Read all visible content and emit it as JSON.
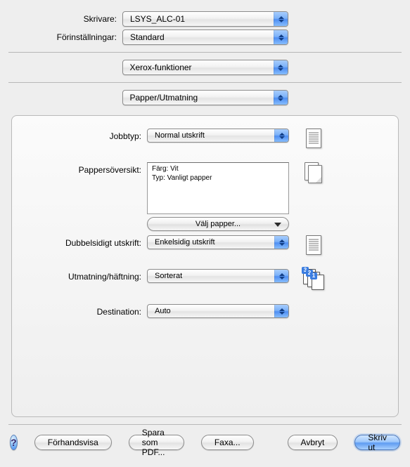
{
  "top": {
    "printer_label": "Skrivare:",
    "printer_value": "LSYS_ALC-01",
    "preset_label": "Förinställningar:",
    "preset_value": "Standard",
    "feature_group": "Xerox-funktioner",
    "feature_sub": "Papper/Utmatning"
  },
  "panel": {
    "jobtype_label": "Jobbtyp:",
    "jobtype_value": "Normal utskrift",
    "paper_label": "Pappersöversikt:",
    "paper_line1": "Färg: Vit",
    "paper_line2": "Typ: Vanligt papper",
    "paper_picker": "Välj papper...",
    "duplex_label": "Dubbelsidigt utskrift:",
    "duplex_value": "Enkelsidig utskrift",
    "output_label": "Utmatning/häftning:",
    "output_value": "Sorterat",
    "dest_label": "Destination:",
    "dest_value": "Auto"
  },
  "footer": {
    "help": "?",
    "preview": "Förhandsvisa",
    "save_pdf": "Spara som PDF...",
    "fax": "Faxa...",
    "cancel": "Avbryt",
    "print": "Skriv ut"
  }
}
